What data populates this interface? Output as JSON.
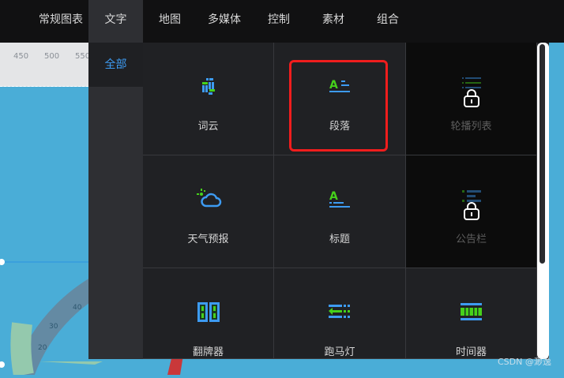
{
  "nav": {
    "tabs": [
      "常规图表",
      "文字",
      "地图",
      "多媒体",
      "控制",
      "素材",
      "组合"
    ],
    "active": "文字"
  },
  "ruler": {
    "ticks": [
      "450",
      "500",
      "550"
    ]
  },
  "gauge": {
    "labels": [
      "40",
      "30",
      "20"
    ]
  },
  "panel": {
    "side": [
      "全部"
    ],
    "items": [
      {
        "label": "词云",
        "icon": "word-cloud-icon",
        "locked": false
      },
      {
        "label": "段落",
        "icon": "paragraph-icon",
        "locked": false,
        "highlighted": true
      },
      {
        "label": "轮播列表",
        "icon": "carousel-list-icon",
        "locked": true
      },
      {
        "label": "天气预报",
        "icon": "weather-icon",
        "locked": false
      },
      {
        "label": "标题",
        "icon": "title-icon",
        "locked": false
      },
      {
        "label": "公告栏",
        "icon": "bulletin-icon",
        "locked": true
      },
      {
        "label": "翻牌器",
        "icon": "flip-counter-icon",
        "locked": false
      },
      {
        "label": "跑马灯",
        "icon": "marquee-icon",
        "locked": false
      },
      {
        "label": "时间器",
        "icon": "timer-icon",
        "locked": false
      }
    ]
  },
  "colors": {
    "accent": "#3d9bf2",
    "green": "#46d11b",
    "highlight": "#f01d1d",
    "canvas": "#4aadd7"
  },
  "watermark": "CSDN @渺逸"
}
